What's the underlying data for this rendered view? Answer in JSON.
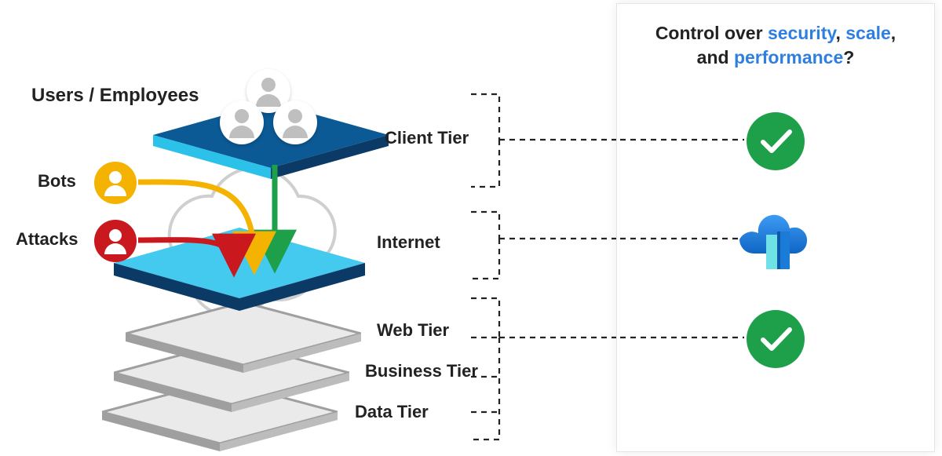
{
  "labels": {
    "users": "Users / Employees",
    "bots": "Bots",
    "attacks": "Attacks",
    "client": "Client Tier",
    "internet": "Internet",
    "web": "Web Tier",
    "business": "Business Tier",
    "data": "Data Tier"
  },
  "panel": {
    "t1": "Control over ",
    "hl1": "security",
    "sep1": ", ",
    "hl2": "scale",
    "sep2": ",",
    "t2": "and ",
    "hl3": "performance",
    "q": "?"
  },
  "colors": {
    "green": "#1ea04b",
    "gold": "#f5b301",
    "red": "#c9181e",
    "blue": "#2f7fe0",
    "navy": "#0b3a66",
    "sky": "#2bc1e8",
    "cyan": "#3fd3f0",
    "grey": "#bcbcbc",
    "greyFill": "#eaeaea"
  },
  "icons": {
    "user": "user-icon",
    "check": "check-icon",
    "cloud": "cloud-icon",
    "frontdoor": "azure-front-door-icon"
  }
}
